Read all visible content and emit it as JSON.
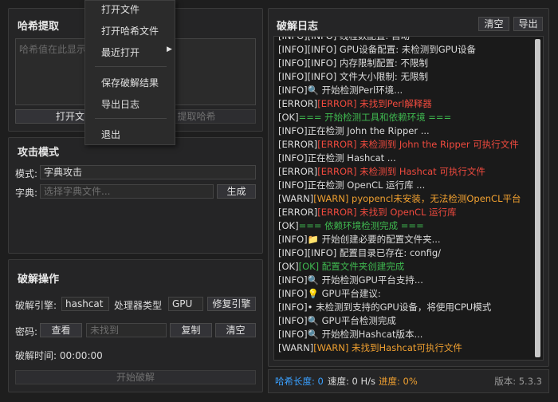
{
  "hash_panel": {
    "title": "哈希提取",
    "textarea_placeholder": "哈希值在此显示",
    "open_file_button": "打开文件",
    "extract_hash_button": "提取哈希"
  },
  "attack_panel": {
    "title": "攻击模式",
    "mode_label": "模式:",
    "mode_value": "字典攻击",
    "dict_label": "字典:",
    "dict_placeholder": "选择字典文件...",
    "generate_button": "生成"
  },
  "crack_panel": {
    "title": "破解操作",
    "engine_label": "破解引擎:",
    "engine_value": "hashcat",
    "processor_label": "处理器类型",
    "processor_value": "GPU",
    "fix_engine_button": "修复引擎",
    "password_label": "密码:",
    "view_button": "查看",
    "password_value": "未找到",
    "copy_button": "复制",
    "clear_button": "清空",
    "time_label": "破解时间: 00:00:00",
    "start_button": "开始破解"
  },
  "log_panel": {
    "title": "破解日志",
    "clear_button": "清空",
    "export_button": "导出",
    "lines": [
      {
        "prefix": "[INFO]",
        "text": "[INFO] 线程数配置: 自动",
        "color": ""
      },
      {
        "prefix": "[INFO]",
        "text": "[INFO] GPU设备配置: 未检测到GPU设备",
        "color": ""
      },
      {
        "prefix": "[INFO]",
        "text": "[INFO] 内存限制配置: 不限制",
        "color": ""
      },
      {
        "prefix": "[INFO]",
        "text": "[INFO] 文件大小限制: 无限制",
        "color": ""
      },
      {
        "prefix": "[INFO]",
        "text": "🔍 开始检测Perl环境...",
        "color": ""
      },
      {
        "prefix": "[ERROR]",
        "text": "[ERROR] 未找到Perl解释器",
        "color": "red"
      },
      {
        "prefix": "[OK]",
        "text": "=== 开始检测工具和依赖环境 ===",
        "color": "green"
      },
      {
        "prefix": "[INFO]",
        "text": "正在检测 John the Ripper ...",
        "color": ""
      },
      {
        "prefix": "[ERROR]",
        "text": "[ERROR] 未检测到 John the Ripper 可执行文件",
        "color": "red"
      },
      {
        "prefix": "[INFO]",
        "text": "正在检测 Hashcat ...",
        "color": ""
      },
      {
        "prefix": "[ERROR]",
        "text": "[ERROR] 未检测到 Hashcat 可执行文件",
        "color": "red"
      },
      {
        "prefix": "[INFO]",
        "text": "正在检测 OpenCL 运行库 ...",
        "color": ""
      },
      {
        "prefix": "[WARN]",
        "text": "[WARN] pyopencl未安装，无法检测OpenCL平台",
        "color": "orange"
      },
      {
        "prefix": "[ERROR]",
        "text": "[ERROR] 未找到 OpenCL 运行库",
        "color": "red"
      },
      {
        "prefix": "[OK]",
        "text": "=== 依赖环境检测完成 ===",
        "color": "green"
      },
      {
        "prefix": "[INFO]",
        "text": "📁 开始创建必要的配置文件夹...",
        "color": ""
      },
      {
        "prefix": "[INFO]",
        "text": "[INFO] 配置目录已存在: config/",
        "color": ""
      },
      {
        "prefix": "[OK]",
        "text": "[OK] 配置文件夹创建完成",
        "color": "green"
      },
      {
        "prefix": "[INFO]",
        "text": "🔍 开始检测GPU平台支持...",
        "color": ""
      },
      {
        "prefix": "[INFO]",
        "text": "💡 GPU平台建议:",
        "color": ""
      },
      {
        "prefix": "[INFO]",
        "text": "• 未检测到支持的GPU设备，将使用CPU模式",
        "color": ""
      },
      {
        "prefix": "[INFO]",
        "text": "🔍 GPU平台检测完成",
        "color": ""
      },
      {
        "prefix": "[INFO]",
        "text": "🔍 开始检测Hashcat版本...",
        "color": ""
      },
      {
        "prefix": "[WARN]",
        "text": "[WARN] 未找到Hashcat可执行文件",
        "color": "orange"
      }
    ]
  },
  "status_bar": {
    "hash_length": "哈希长度: 0",
    "speed": "速度: 0 H/s",
    "progress": "进度: 0%",
    "version": "版本: 5.3.3"
  },
  "file_menu": {
    "open_file": "打开文件",
    "open_hash_file": "打开哈希文件",
    "recent_open": "最近打开",
    "save_result": "保存破解结果",
    "export_log": "导出日志",
    "exit": "退出"
  },
  "colors": {
    "red": "#f04a3e",
    "green": "#3fb950",
    "orange": "#f0a030",
    "accent_blue": "#3aa0ff"
  }
}
